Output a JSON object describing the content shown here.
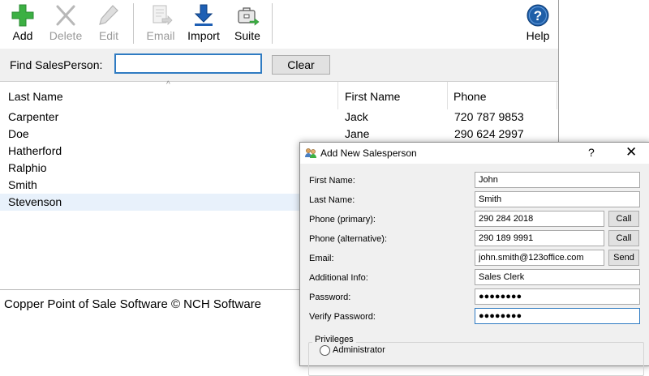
{
  "toolbar": {
    "add": "Add",
    "delete": "Delete",
    "edit": "Edit",
    "email": "Email",
    "import": "Import",
    "suite": "Suite",
    "help": "Help"
  },
  "find": {
    "label": "Find SalesPerson:",
    "value": "",
    "clear": "Clear"
  },
  "table": {
    "headers": [
      "Last Name",
      "First Name",
      "Phone"
    ],
    "rows": [
      {
        "last": "Carpenter",
        "first": "Jack",
        "phone": "720 787 9853"
      },
      {
        "last": "Doe",
        "first": "Jane",
        "phone": "290 624 2997"
      },
      {
        "last": "Hatherford",
        "first": "",
        "phone": ""
      },
      {
        "last": "Ralphio",
        "first": "",
        "phone": ""
      },
      {
        "last": "Smith",
        "first": "",
        "phone": ""
      },
      {
        "last": "Stevenson",
        "first": "",
        "phone": ""
      }
    ],
    "selected_row": 5
  },
  "status": "Copper Point of Sale Software © NCH Software",
  "dialog": {
    "title": "Add New Salesperson",
    "help": "?",
    "close": "✕",
    "labels": {
      "first": "First Name:",
      "last": "Last Name:",
      "phone1": "Phone (primary):",
      "phone2": "Phone (alternative):",
      "email": "Email:",
      "info": "Additional Info:",
      "password": "Password:",
      "verify": "Verify Password:"
    },
    "values": {
      "first": "John",
      "last": "Smith",
      "phone1": "290 284 2018",
      "phone2": "290 189 9991",
      "email": "john.smith@123office.com",
      "info": "Sales Clerk",
      "password": "●●●●●●●●",
      "verify": "●●●●●●●●"
    },
    "buttons": {
      "call": "Call",
      "send": "Send"
    },
    "privileges": {
      "legend": "Privileges",
      "options": [
        "Administrator"
      ]
    }
  },
  "colors": {
    "accent": "#2f7bc2",
    "add_green": "#3cb043",
    "import_blue": "#1e5fb4",
    "help_blue": "#1f5fa8"
  }
}
